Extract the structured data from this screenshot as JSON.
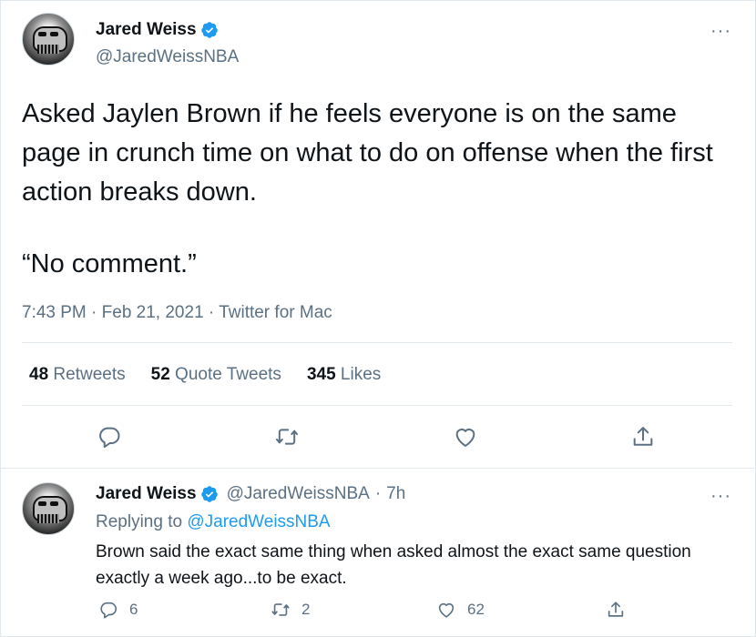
{
  "tweet": {
    "author_name": "Jared Weiss",
    "author_handle": "@JaredWeissNBA",
    "paragraph1": "Asked Jaylen Brown if he feels everyone is on the same page in crunch time on what to do on offense when the first action breaks down.",
    "paragraph2": "“No comment.”",
    "time": "7:43 PM",
    "date": "Feb 21, 2021",
    "source": "Twitter for Mac",
    "separator": "·",
    "more_label": "···",
    "stats": {
      "retweets_count": "48",
      "retweets_label": "Retweets",
      "quotes_count": "52",
      "quotes_label": "Quote Tweets",
      "likes_count": "345",
      "likes_label": "Likes"
    }
  },
  "reply": {
    "author_name": "Jared Weiss",
    "author_handle": "@JaredWeissNBA",
    "separator": "·",
    "age": "7h",
    "more_label": "···",
    "replying_to_prefix": "Replying to",
    "replying_to_handle": "@JaredWeissNBA",
    "text": "Brown said the exact same thing when asked almost the exact same question exactly a week ago...to be exact.",
    "reply_count": "6",
    "retweet_count": "2",
    "like_count": "62"
  },
  "icons": {
    "reply": "reply-icon",
    "retweet": "retweet-icon",
    "like": "heart-icon",
    "share": "share-icon",
    "verified": "verified-badge-icon"
  },
  "colors": {
    "accent": "#1d9bf0",
    "secondary_text": "#5b7083",
    "divider": "#e1e8ed"
  }
}
